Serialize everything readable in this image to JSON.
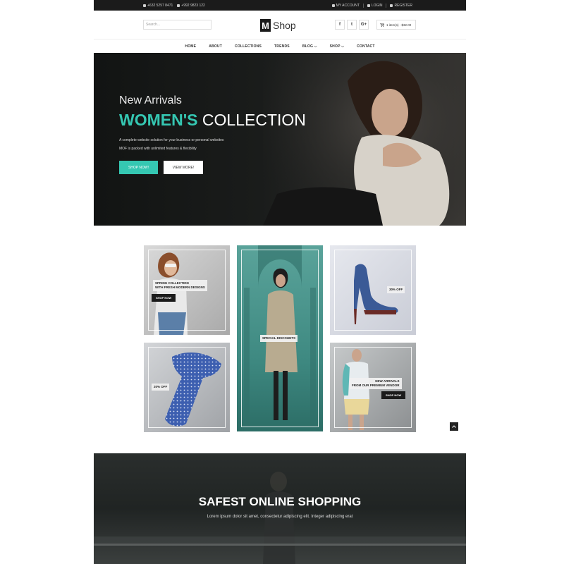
{
  "topbar": {
    "phone1": "+632 5257 8471",
    "phone2": "+992 9823 122",
    "my_account": "MY ACCOUNT",
    "login": "LOGIN",
    "register": "REGISTER"
  },
  "header": {
    "search_placeholder": "Search...",
    "logo_mark": "M",
    "logo_word": "Shop",
    "social": [
      "f",
      "t",
      "G+"
    ],
    "cart": "1 item(s) - $32.00"
  },
  "nav": {
    "items": [
      "HOME",
      "ABOUT",
      "COLLECTIONS",
      "TRENDS",
      "BLOG ⌵",
      "SHOP ⌵",
      "CONTACT"
    ]
  },
  "hero": {
    "subtitle": "New Arrivals",
    "title_accent": "WOMEN'S",
    "title_rest": "COLLECTION",
    "desc_line1": "A complete website solution for your business or personal websites",
    "desc_line2": "MOF is packed with unlimited features & flexibility",
    "btn_shop": "SHOP NOW!",
    "btn_view": "VIEW MORE!"
  },
  "tiles": {
    "t1_tag_line1": "SPRING COLLECTION",
    "t1_tag_line2": "WITH FRESH MODERN DESIGNS",
    "t1_btn": "SHOP NOW",
    "t2_tag": "SPECIAL DISCOUNTS",
    "t3_tag": "30% OFF",
    "t4_tag": "20% OFF",
    "t5_tag_line1": "NEW ARRIVALS",
    "t5_tag_line2": "FROM OUR PREMIUM VENDOR",
    "t5_btn": "SHOP NOW"
  },
  "banner": {
    "title": "SAFEST ONLINE SHOPPING",
    "text": "Lorem ipsum dolor sit amet, consectetur adipiscing elit. Integer adipiscing erat"
  },
  "colors": {
    "accent": "#35c7b2",
    "dark": "#1b1b1b"
  }
}
